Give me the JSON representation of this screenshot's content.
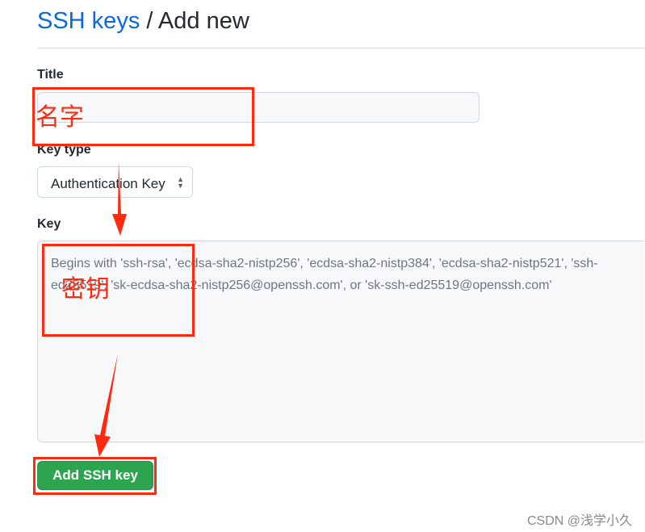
{
  "header": {
    "link": "SSH keys",
    "separator": " / ",
    "title": "Add new"
  },
  "form": {
    "title_label": "Title",
    "title_value": "",
    "key_type_label": "Key type",
    "key_type_selected": "Authentication Key",
    "key_label": "Key",
    "key_placeholder_line1": "Begins with 'ssh-rsa', 'ecdsa-sha2-nistp256', 'ecdsa-sha2-nistp384', 'ecdsa-sha2-nistp521', 'ssh-ed25519', 'sk-ecdsa-",
    "key_placeholder_line2": "sha2-nistp256@openssh.com', or 'sk-ssh-ed25519@openssh.com'",
    "submit_label": "Add SSH key"
  },
  "annotations": {
    "title_note": "名字",
    "key_note": "密钥",
    "color": "#ff2a10"
  },
  "watermark": "CSDN @浅学小久",
  "colors": {
    "link": "#0969da",
    "button": "#2da44e"
  }
}
